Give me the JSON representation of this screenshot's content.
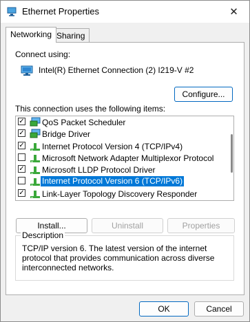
{
  "window": {
    "title": "Ethernet Properties"
  },
  "tabs": [
    {
      "label": "Networking"
    },
    {
      "label": "Sharing"
    }
  ],
  "connect_using": {
    "label": "Connect using:",
    "adapter": "Intel(R) Ethernet Connection (2) I219-V #2",
    "configure_button": "Configure..."
  },
  "items_section": {
    "label": "This connection uses the following items:",
    "items": [
      {
        "label": "QoS Packet Scheduler",
        "checked": true,
        "icon": "network-service-icon"
      },
      {
        "label": "Bridge Driver",
        "checked": true,
        "icon": "network-service-icon"
      },
      {
        "label": "Internet Protocol Version 4 (TCP/IPv4)",
        "checked": true,
        "icon": "protocol-icon"
      },
      {
        "label": "Microsoft Network Adapter Multiplexor Protocol",
        "checked": false,
        "icon": "protocol-icon"
      },
      {
        "label": "Microsoft LLDP Protocol Driver",
        "checked": true,
        "icon": "protocol-icon"
      },
      {
        "label": "Internet Protocol Version 6 (TCP/IPv6)",
        "checked": false,
        "icon": "protocol-icon",
        "selected": true
      },
      {
        "label": "Link-Layer Topology Discovery Responder",
        "checked": true,
        "icon": "protocol-icon"
      }
    ]
  },
  "actions": {
    "install": "Install...",
    "uninstall": "Uninstall",
    "properties": "Properties"
  },
  "description": {
    "legend": "Description",
    "text": "TCP/IP version 6. The latest version of the internet protocol that provides communication across diverse interconnected networks."
  },
  "footer": {
    "ok": "OK",
    "cancel": "Cancel"
  },
  "colors": {
    "selection": "#0078d7",
    "primary_border": "#0067c0"
  }
}
